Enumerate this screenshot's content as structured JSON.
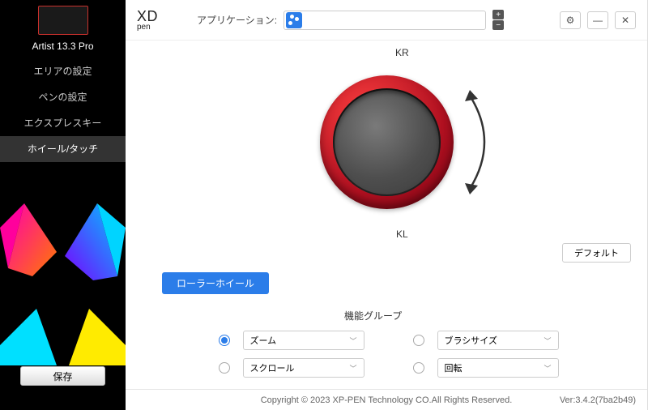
{
  "device": {
    "title": "Artist 13.3 Pro"
  },
  "sidebar": {
    "items": [
      {
        "label": "エリアの設定"
      },
      {
        "label": "ペンの設定"
      },
      {
        "label": "エクスプレスキー"
      },
      {
        "label": "ホイール/タッチ"
      }
    ],
    "save_label": "保存"
  },
  "topbar": {
    "logo_top": "XD",
    "logo_bottom": "pen",
    "app_label": "アプリケーション:",
    "plus": "+",
    "minus": "−",
    "gear": "⚙",
    "minimize": "—",
    "close": "✕"
  },
  "wheel": {
    "kr": "KR",
    "kl": "KL",
    "default_label": "デフォルト"
  },
  "tabs": {
    "roller_label": "ローラーホイール"
  },
  "group": {
    "title": "機能グループ",
    "options": [
      {
        "label": "ズーム",
        "checked": true
      },
      {
        "label": "ブラシサイズ",
        "checked": false
      },
      {
        "label": "スクロール",
        "checked": false
      },
      {
        "label": "回転",
        "checked": false
      }
    ]
  },
  "footer": {
    "copyright": "Copyright © 2023  XP-PEN Technology CO.All Rights Reserved.",
    "version": "Ver:3.4.2(7ba2b49)"
  }
}
